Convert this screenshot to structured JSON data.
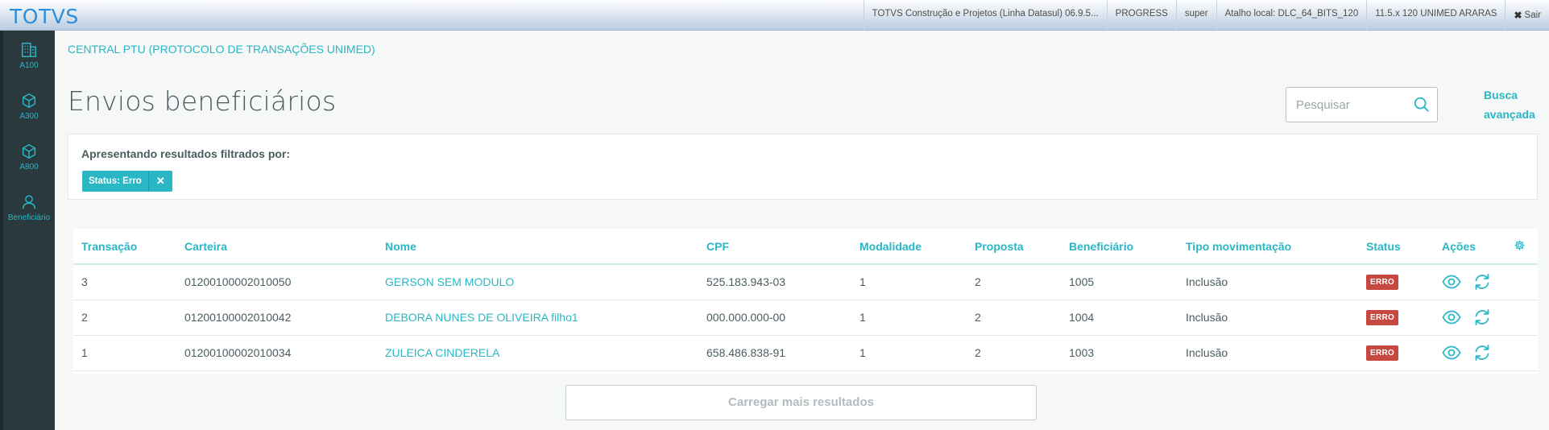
{
  "brand": "TOTVS",
  "topbar": {
    "items": [
      "TOTVS Construção e Projetos (Linha Datasul) 06.9.5...",
      "PROGRESS",
      "super",
      "Atalho local: DLC_64_BITS_120",
      "11.5.x 120 UNIMED ARARAS"
    ],
    "exit_label": "Sair"
  },
  "sidebar": {
    "items": [
      {
        "label": "A100",
        "icon": "building-icon"
      },
      {
        "label": "A300",
        "icon": "cube-icon"
      },
      {
        "label": "A800",
        "icon": "cube-icon"
      },
      {
        "label": "Beneficiário",
        "icon": "user-icon"
      }
    ]
  },
  "breadcrumb": "CENTRAL PTU (PROTOCOLO DE TRANSAÇÕES UNIMED)",
  "page_title": "Envios beneficiários",
  "search": {
    "placeholder": "Pesquisar",
    "value": ""
  },
  "advanced_search": "Busca avançada",
  "filters": {
    "label": "Apresentando resultados filtrados por:",
    "tags": [
      {
        "text": "Status: Erro",
        "close": "✕"
      }
    ]
  },
  "table": {
    "columns": [
      "Transação",
      "Carteira",
      "Nome",
      "CPF",
      "Modalidade",
      "Proposta",
      "Beneficiário",
      "Tipo movimentação",
      "Status",
      "Ações"
    ],
    "rows": [
      {
        "transacao": "3",
        "carteira": "01200100002010050",
        "nome": "GERSON SEM MODULO",
        "cpf": "525.183.943-03",
        "modalidade": "1",
        "proposta": "2",
        "beneficiario": "1005",
        "tipo": "Inclusão",
        "status": "ERRO"
      },
      {
        "transacao": "2",
        "carteira": "01200100002010042",
        "nome": "DEBORA NUNES DE OLIVEIRA filho1",
        "cpf": "000.000.000-00",
        "modalidade": "1",
        "proposta": "2",
        "beneficiario": "1004",
        "tipo": "Inclusão",
        "status": "ERRO"
      },
      {
        "transacao": "1",
        "carteira": "01200100002010034",
        "nome": "ZULEICA CINDERELA",
        "cpf": "658.486.838-91",
        "modalidade": "1",
        "proposta": "2",
        "beneficiario": "1003",
        "tipo": "Inclusão",
        "status": "ERRO"
      }
    ]
  },
  "load_more": "Carregar mais resultados",
  "colors": {
    "accent": "#29b6c5",
    "sidebar": "#2a393e",
    "error": "#c64840"
  }
}
